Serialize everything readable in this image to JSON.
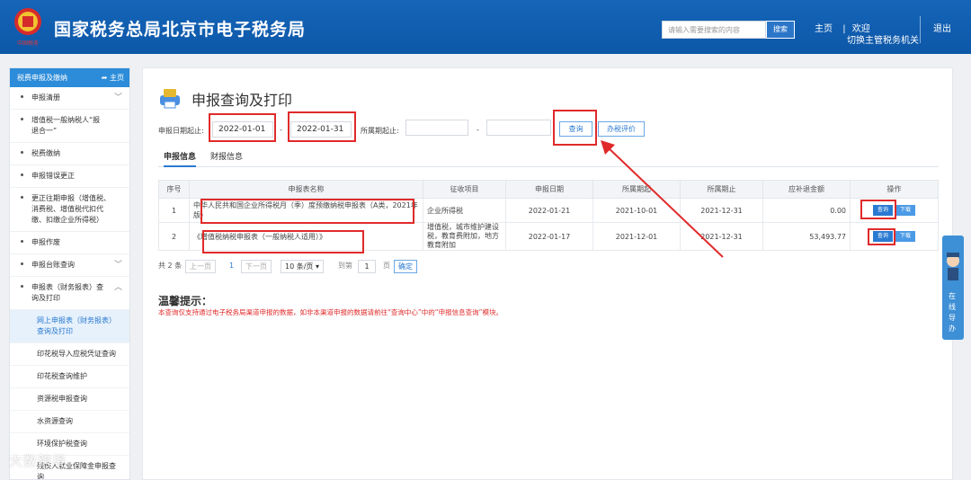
{
  "header": {
    "title": "国家税务总局北京市电子税务局",
    "search_placeholder": "请输入需要搜索的内容",
    "search_button": "搜索",
    "home": "主页",
    "welcome": "欢迎",
    "switch_user": "切换主管税务机关",
    "logout": "退出",
    "logo_text": "中国税务"
  },
  "sidebar": {
    "title": "税费申报及缴纳",
    "home": "主页",
    "items": [
      {
        "label": "申报清册"
      },
      {
        "label": "增值税一般纳税人“报退合一”"
      },
      {
        "label": "税费缴纳"
      },
      {
        "label": "申报错误更正"
      },
      {
        "label": "更正往期申报（增值税、消费税、增值税代扣代缴、扣缴企业所得税）"
      },
      {
        "label": "申报作废"
      },
      {
        "label": "申报台账查询"
      },
      {
        "label": "申报表（财务报表）查询及打印"
      }
    ],
    "subitems": [
      {
        "label": "网上申报表（财务报表）查询及打印"
      },
      {
        "label": "印花税导入应税凭证查询"
      },
      {
        "label": "印花税查询维护"
      },
      {
        "label": "资源税申报查询"
      },
      {
        "label": "水资源查询"
      },
      {
        "label": "环境保护税查询"
      },
      {
        "label": "残疾人就业保障金申报查询"
      }
    ]
  },
  "main": {
    "title": "申报查询及打印",
    "filter": {
      "date_label": "申报日期起止:",
      "date_from": "2022-01-01",
      "date_to": "2022-01-31",
      "sep1": "-",
      "period_label": "所属期起止:",
      "sep2": "-",
      "query_button": "查询",
      "eval_button": "办税评价"
    },
    "tabs": [
      {
        "label": "申报信息"
      },
      {
        "label": "财报信息"
      }
    ],
    "table": {
      "headers": [
        "序号",
        "申报表名称",
        "征收项目",
        "申报日期",
        "所属期起",
        "所属期止",
        "应补退金额",
        "操作"
      ],
      "rows": [
        {
          "no": "1",
          "name": "中华人民共和国企业所得税月（季）度预缴纳税申报表（A类，2021年版）",
          "item": "企业所得税",
          "date": "2022-01-21",
          "from": "2021-10-01",
          "to": "2021-12-31",
          "amount": "0.00",
          "op_query": "查询",
          "op_dl": "下载"
        },
        {
          "no": "2",
          "name": "《增值税纳税申报表（一般纳税人适用）》",
          "item": "增值税，城市维护建设税，教育费附加，地方教育附加",
          "date": "2022-01-17",
          "from": "2021-12-01",
          "to": "2021-12-31",
          "amount": "53,493.77",
          "op_query": "查询",
          "op_dl": "下载"
        }
      ]
    },
    "pager": {
      "total": "共 2 条",
      "prev": "上一页",
      "current": "1",
      "next": "下一页",
      "page_size": "10 条/页",
      "goto": "到第",
      "goto_value": "1",
      "page_unit": "页",
      "confirm": "确定"
    },
    "tip_title": "温馨提示：",
    "tip_text": "本查询仅支持通过电子税务局渠道申报的数据，如非本渠道申报的数据请前往“查询中心”中的“申报信息查询”模块。"
  },
  "float_help": {
    "label": "在线导办"
  },
  "watermark": "大数跨境",
  "colors": {
    "header": "#1565b8",
    "accent": "#2a7ad2",
    "highlight": "#e02a2a"
  }
}
